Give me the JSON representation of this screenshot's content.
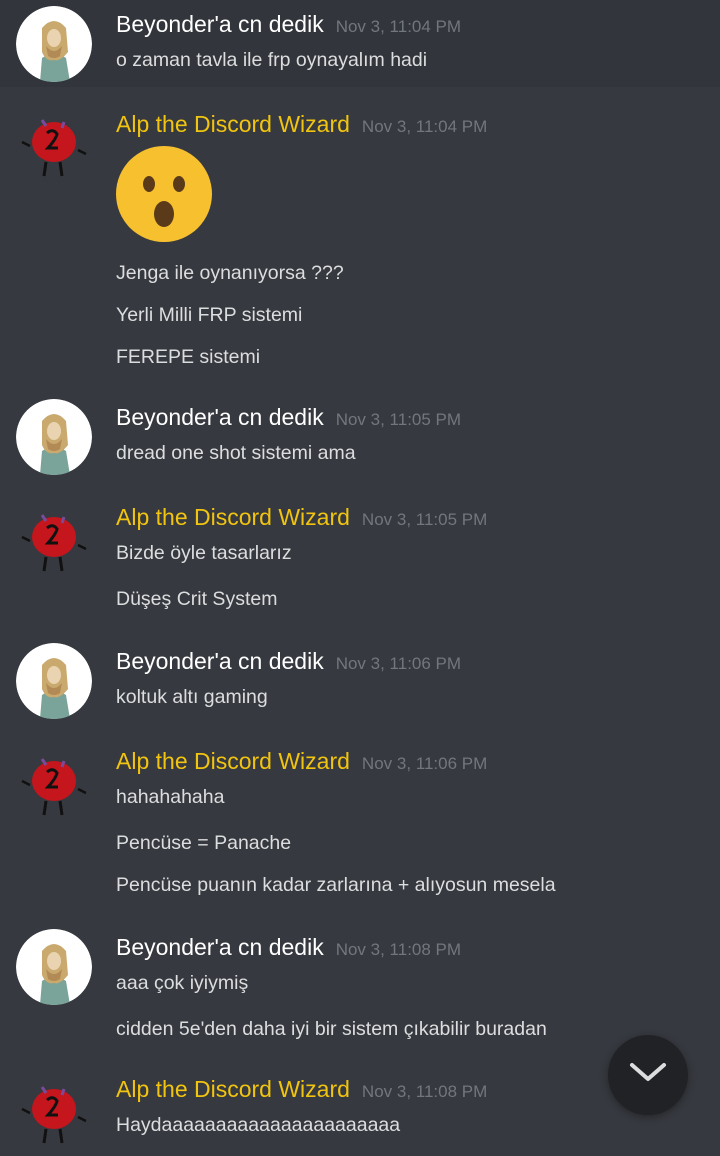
{
  "users": {
    "beyonder": {
      "name": "Beyonder'a cn dedik",
      "name_color": "#ffffff",
      "avatar": "longhaired-portrait-avatar"
    },
    "alp": {
      "name": "Alp the Discord Wizard",
      "name_color": "#f1c40f",
      "avatar": "red-dice-creature-avatar"
    }
  },
  "messages": [
    {
      "author": "Beyonder'a cn dedik",
      "time": "Nov 3, 11:04 PM",
      "lines": [
        "o zaman tavla ile frp oynayalım hadi"
      ]
    },
    {
      "author": "Alp the Discord Wizard",
      "time": "Nov 3, 11:04 PM",
      "emoji": "astonished-face-emoji",
      "lines": [
        "Jenga ile oynanıyorsa ???",
        "Yerli Milli FRP sistemi",
        "FEREPE sistemi"
      ]
    },
    {
      "author": "Beyonder'a cn dedik",
      "time": "Nov 3, 11:05 PM",
      "lines": [
        "dread one shot sistemi ama"
      ]
    },
    {
      "author": "Alp the Discord Wizard",
      "time": "Nov 3, 11:05 PM",
      "lines": [
        "Bizde öyle tasarlarız",
        "Düşeş Crit System"
      ]
    },
    {
      "author": "Beyonder'a cn dedik",
      "time": "Nov 3, 11:06 PM",
      "lines": [
        "koltuk altı gaming"
      ]
    },
    {
      "author": "Alp the Discord Wizard",
      "time": "Nov 3, 11:06 PM",
      "lines": [
        "hahahahaha",
        "Pencüse = Panache",
        "Pencüse puanın kadar zarlarına + alıyosun mesela"
      ]
    },
    {
      "author": "Beyonder'a cn dedik",
      "time": "Nov 3, 11:08 PM",
      "lines": [
        "aaa çok iyiymiş",
        "cidden 5e'den daha iyi bir sistem çıkabilir buradan"
      ]
    },
    {
      "author": "Alp the Discord Wizard",
      "time": "Nov 3, 11:08 PM",
      "lines": [
        "Haydaaaaaaaaaaaaaaaaaaaaaa"
      ]
    }
  ],
  "colors": {
    "background": "#36393f",
    "highlight_row": "#32353b",
    "message_text": "#dcddde",
    "timestamp": "#72767d",
    "scroll_button": "#202225"
  },
  "scroll_button": {
    "icon": "chevron-down-icon"
  }
}
